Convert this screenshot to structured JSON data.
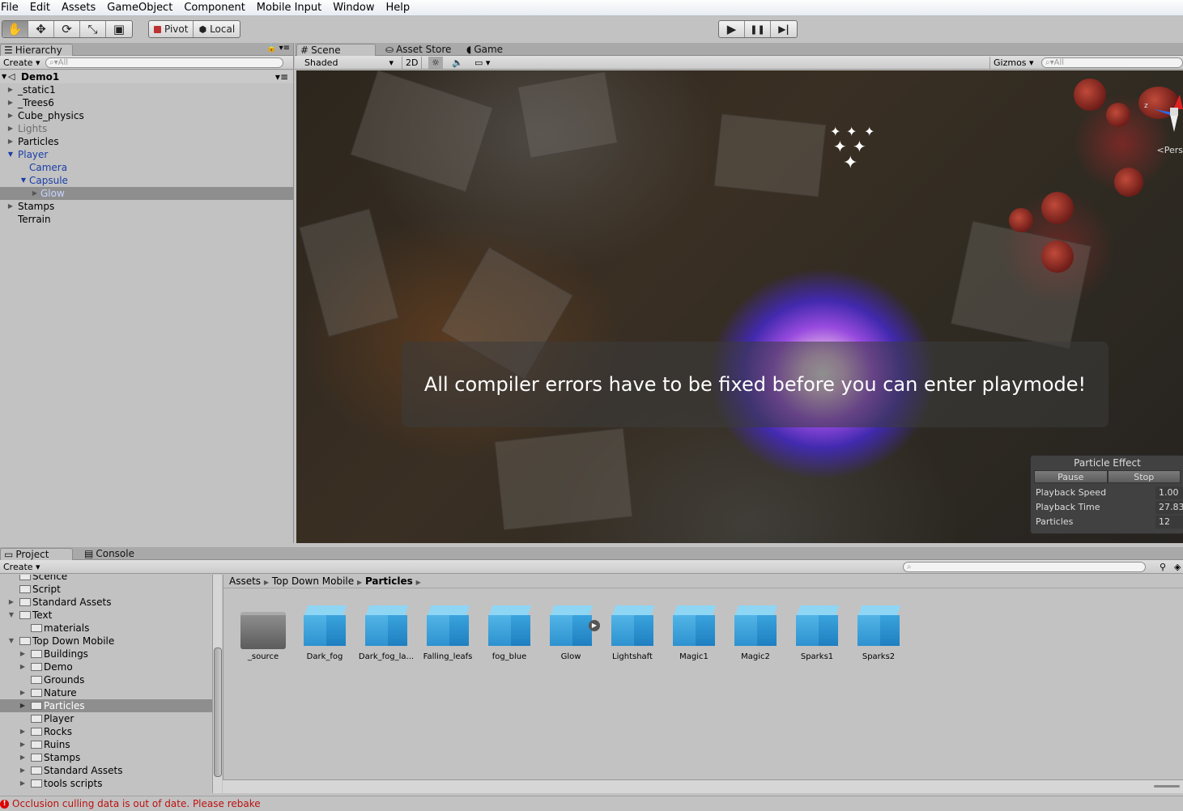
{
  "menu": [
    "File",
    "Edit",
    "Assets",
    "GameObject",
    "Component",
    "Mobile Input",
    "Window",
    "Help"
  ],
  "toolbar": {
    "tools": [
      "hand-tool",
      "move-tool",
      "rotate-tool",
      "scale-tool",
      "rect-tool"
    ],
    "pivot_label": "Pivot",
    "local_label": "Local",
    "play": "▶",
    "pause": "❚❚",
    "step": "▶|"
  },
  "hierarchy": {
    "tab": "Hierarchy",
    "create": "Create",
    "search_placeholder": "All",
    "scene": "Demo1",
    "items": [
      {
        "label": "_static1"
      },
      {
        "label": "_Trees6"
      },
      {
        "label": "Cube_physics"
      },
      {
        "label": "Lights"
      },
      {
        "label": "Particles"
      },
      {
        "label": "Player"
      },
      {
        "label": "Camera"
      },
      {
        "label": "Capsule"
      },
      {
        "label": "Glow"
      },
      {
        "label": "Stamps"
      },
      {
        "label": "Terrain"
      }
    ]
  },
  "scene_view": {
    "tabs": [
      "Scene",
      "Asset Store",
      "Game"
    ],
    "shading": "Shaded",
    "mode_2d": "2D",
    "gizmos": "Gizmos",
    "search_placeholder": "All",
    "persp": "Pers",
    "gizmo_axis": "z",
    "error_message": "All compiler errors have to be fixed before you can enter playmode!"
  },
  "particle_effect": {
    "title": "Particle Effect",
    "pause": "Pause",
    "stop": "Stop",
    "rows": [
      {
        "label": "Playback Speed",
        "value": "1.00"
      },
      {
        "label": "Playback Time",
        "value": "27.83"
      },
      {
        "label": "Particles",
        "value": "12"
      }
    ]
  },
  "project": {
    "tabs": [
      "Project",
      "Console"
    ],
    "create": "Create",
    "tree": [
      {
        "label": "Scence"
      },
      {
        "label": "Script"
      },
      {
        "label": "Standard Assets"
      },
      {
        "label": "Text"
      },
      {
        "label": "materials"
      },
      {
        "label": "Top Down Mobile"
      },
      {
        "label": "Buildings"
      },
      {
        "label": "Demo"
      },
      {
        "label": "Grounds"
      },
      {
        "label": "Nature"
      },
      {
        "label": "Particles"
      },
      {
        "label": "Player"
      },
      {
        "label": "Rocks"
      },
      {
        "label": "Ruins"
      },
      {
        "label": "Stamps"
      },
      {
        "label": "Standard Assets"
      },
      {
        "label": "tools scripts"
      }
    ],
    "breadcrumb": [
      "Assets",
      "Top Down Mobile",
      "Particles"
    ],
    "assets": [
      {
        "label": "_source"
      },
      {
        "label": "Dark_fog"
      },
      {
        "label": "Dark_fog_la..."
      },
      {
        "label": "Falling_leafs"
      },
      {
        "label": "fog_blue"
      },
      {
        "label": "Glow"
      },
      {
        "label": "Lightshaft"
      },
      {
        "label": "Magic1"
      },
      {
        "label": "Magic2"
      },
      {
        "label": "Sparks1"
      },
      {
        "label": "Sparks2"
      }
    ]
  },
  "status": {
    "message": "Occlusion culling data is out of date. Please rebake",
    "color": "#b11111"
  }
}
